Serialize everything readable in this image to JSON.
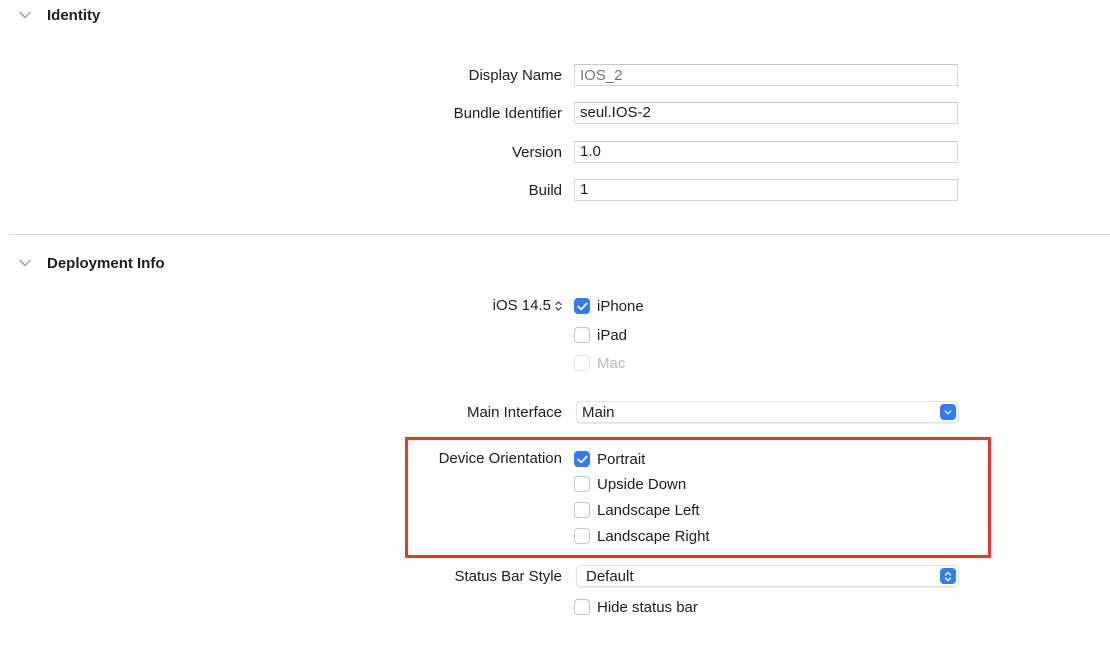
{
  "identity": {
    "title": "Identity",
    "display_name": {
      "label": "Display Name",
      "placeholder": "IOS_2"
    },
    "bundle_identifier": {
      "label": "Bundle Identifier",
      "value": "seul.IOS-2"
    },
    "version": {
      "label": "Version",
      "value": "1.0"
    },
    "build": {
      "label": "Build",
      "value": "1"
    }
  },
  "deployment": {
    "title": "Deployment Info",
    "ios_version": "iOS 14.5",
    "devices": [
      {
        "label": "iPhone",
        "checked": true,
        "enabled": true
      },
      {
        "label": "iPad",
        "checked": false,
        "enabled": true
      },
      {
        "label": "Mac",
        "checked": false,
        "enabled": false
      }
    ],
    "main_interface": {
      "label": "Main Interface",
      "value": "Main"
    },
    "device_orientation": {
      "label": "Device Orientation",
      "options": [
        {
          "label": "Portrait",
          "checked": true
        },
        {
          "label": "Upside Down",
          "checked": false
        },
        {
          "label": "Landscape Left",
          "checked": false
        },
        {
          "label": "Landscape Right",
          "checked": false
        }
      ]
    },
    "status_bar_style": {
      "label": "Status Bar Style",
      "value": "Default"
    },
    "hide_status_bar": {
      "label": "Hide status bar",
      "checked": false
    }
  },
  "colors": {
    "accent": "#2f7cf6",
    "highlight": "#e8392e"
  }
}
